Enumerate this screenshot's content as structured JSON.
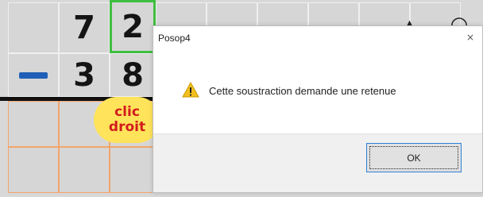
{
  "board": {
    "minuend_digits": [
      "7",
      "2"
    ],
    "subtrahend_digits": [
      "3",
      "8"
    ],
    "operator": "minus",
    "hint_text": [
      "clic",
      "droit"
    ]
  },
  "dialog": {
    "title": "Posop4",
    "close_glyph": "×",
    "message": "Cette soustraction demande une retenue",
    "ok_label": "OK",
    "icon": "warning-icon"
  },
  "colors": {
    "grid_cell": "#d6d6d6",
    "selection": "#3fbf3f",
    "minus": "#1f5fb8",
    "hint_bg": "#ffe35a",
    "hint_text": "#d21c1c"
  }
}
